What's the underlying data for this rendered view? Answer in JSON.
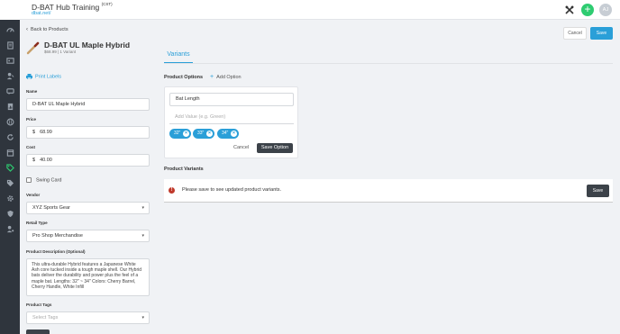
{
  "app": {
    "title": "D-BAT Hub Training",
    "title_suffix": "(CST)",
    "url": "dbat.net/",
    "avatar_initials": "AJ",
    "add_symbol": "+"
  },
  "sidebar": {
    "items": [
      {
        "icon": "speedometer-icon"
      },
      {
        "icon": "book-icon"
      },
      {
        "icon": "id-card-icon"
      },
      {
        "icon": "user-edit-icon"
      },
      {
        "icon": "chat-icon"
      },
      {
        "icon": "report-icon"
      },
      {
        "icon": "baseball-icon"
      },
      {
        "icon": "refresh-icon"
      },
      {
        "icon": "calendar-icon"
      },
      {
        "icon": "price-tag-icon",
        "active": true
      },
      {
        "icon": "tags-icon"
      },
      {
        "icon": "settings-icon"
      },
      {
        "icon": "shield-icon"
      },
      {
        "icon": "user-settings-icon"
      }
    ]
  },
  "header": {
    "back_label": "Back to Products",
    "back_symbol": "‹",
    "product_name": "D-BAT UL Maple Hybrid",
    "product_meta": "$68.99 | 1 Variant",
    "cancel_label": "Cancel",
    "save_label": "Save"
  },
  "left": {
    "print_labels": "Print Labels",
    "name_label": "Name",
    "name_value": "D-BAT UL Maple Hybrid",
    "price_label": "Price",
    "price_prefix": "$",
    "price_value": "68.99",
    "cost_label": "Cost",
    "cost_prefix": "$",
    "cost_value": "40.00",
    "swing_card_label": "Swing Card",
    "vendor_label": "Vendor",
    "vendor_value": "XYZ Sports Gear",
    "retail_type_label": "Retail Type",
    "retail_type_value": "Pro Shop Merchandise",
    "description_label": "Product Description (Optional)",
    "description_value": "This ultra-durable Hybrid features a Japanese White Ash core tucked inside a tough maple shell. Our Hybrid bats deliver the durability and power plus the feel of a maple bat.  Lengths: 32\" ~ 34\" Colors: Cherry Barrel, Cherry Handle, White Infill",
    "tags_label": "Product Tags",
    "tags_placeholder": "Select Tags",
    "caret": "▾"
  },
  "right": {
    "tab_variants": "Variants",
    "product_options_title": "Product Options",
    "add_option_label": "Add Option",
    "add_option_symbol": "+",
    "option_name": "Bat Length",
    "value_placeholder": "Add Value (e.g. Green)",
    "chips": [
      "32\"",
      "33\"",
      "34\""
    ],
    "chip_remove_symbol": "×",
    "option_cancel": "Cancel",
    "option_save": "Save Option",
    "product_variants_title": "Product Variants",
    "warning_symbol": "!",
    "warning_text": "Please save to see updated product variants.",
    "variants_save": "Save"
  },
  "colors": {
    "accent": "#2a9fd8",
    "sidebar_bg": "#2f353d",
    "active_icon": "#2ecc71",
    "fab": "#2ecc71",
    "warning": "#c0392b",
    "dark_button": "#3c4249"
  }
}
